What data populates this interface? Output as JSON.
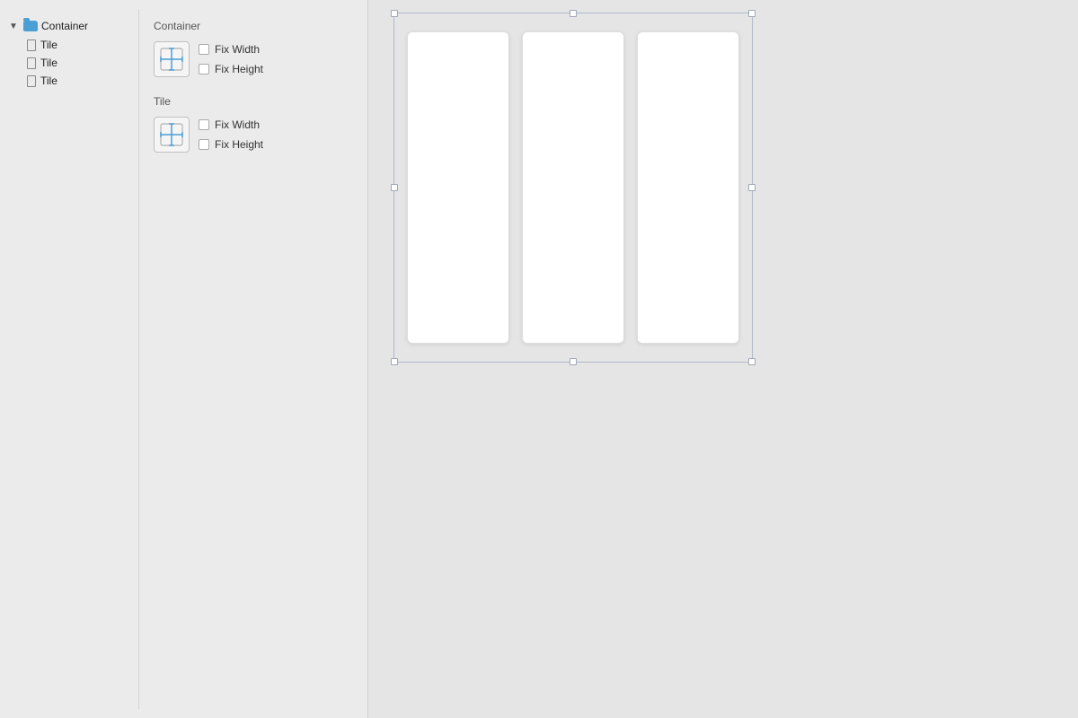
{
  "tree": {
    "container_label": "Container",
    "arrow": "▼",
    "tiles": [
      {
        "label": "Tile"
      },
      {
        "label": "Tile"
      },
      {
        "label": "Tile"
      }
    ]
  },
  "properties": {
    "container": {
      "group_label": "Container",
      "fix_width_label": "Fix Width",
      "fix_height_label": "Fix Height"
    },
    "tile": {
      "group_label": "Tile",
      "fix_width_label": "Fix Width",
      "fix_height_label": "Fix Height"
    }
  },
  "colors": {
    "accent_blue": "#4a9fd4",
    "border": "#c0c0c0",
    "handle": "#a0a8b8",
    "bg_panel": "#ebebeb",
    "bg_canvas": "#e5e5e5"
  }
}
